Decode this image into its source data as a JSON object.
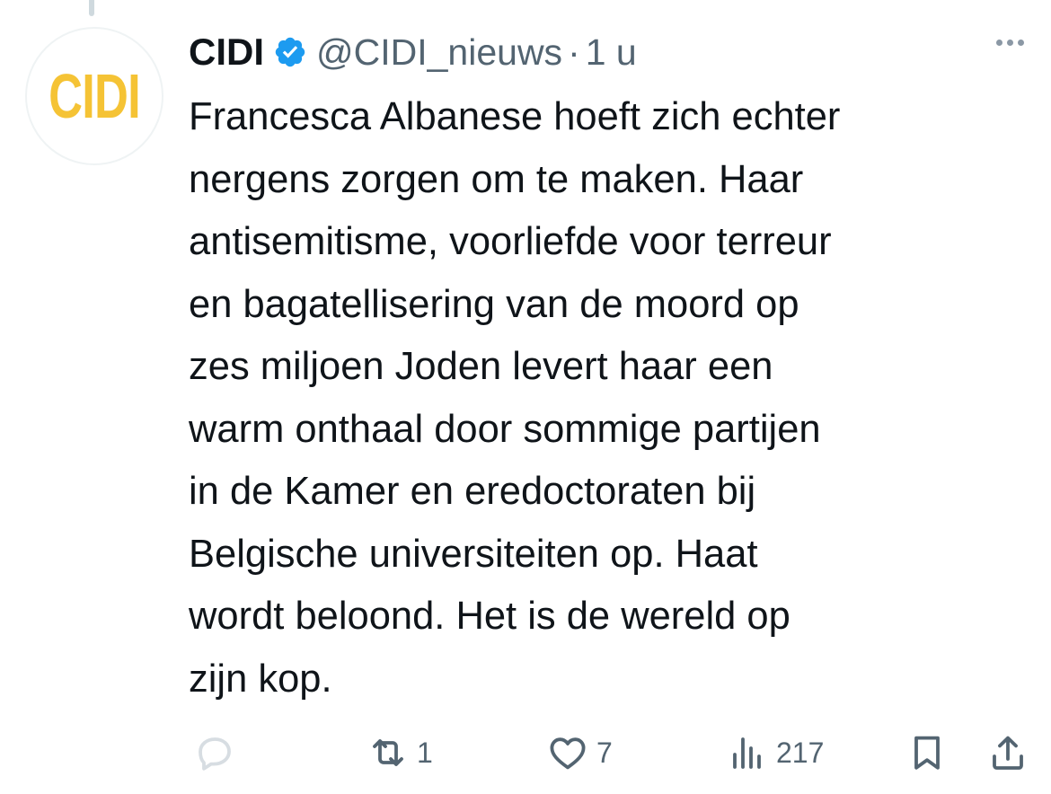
{
  "author": {
    "avatar_text": "CIDI",
    "name": "CIDI",
    "handle": "@CIDI_nieuws",
    "separator": "·",
    "time": "1 u"
  },
  "tweet": {
    "lines": [
      "Francesca Albanese hoeft zich echter",
      "nergens zorgen om te maken. Haar",
      "antisemitisme, voorliefde voor terreur",
      "en bagatellisering van de moord op",
      "zes miljoen Joden levert haar een",
      "warm onthaal door sommige partijen",
      "in de Kamer en eredoctoraten bij",
      "Belgische universiteiten op. Haat",
      "wordt beloond. Het is de wereld op",
      "zijn kop."
    ]
  },
  "actions": {
    "reply_count": "",
    "retweet_count": "1",
    "like_count": "7",
    "views_count": "217"
  },
  "icons": {
    "reply": "reply-icon",
    "retweet": "retweet-icon",
    "like": "heart-icon",
    "views": "views-icon",
    "bookmark": "bookmark-icon",
    "share": "share-icon",
    "verified": "verified-badge-icon",
    "more": "more-icon"
  },
  "colors": {
    "brand_yellow": "#f5c335",
    "verified_blue": "#1d9bf0",
    "muted_text": "#536471",
    "main_text": "#0f1419"
  }
}
